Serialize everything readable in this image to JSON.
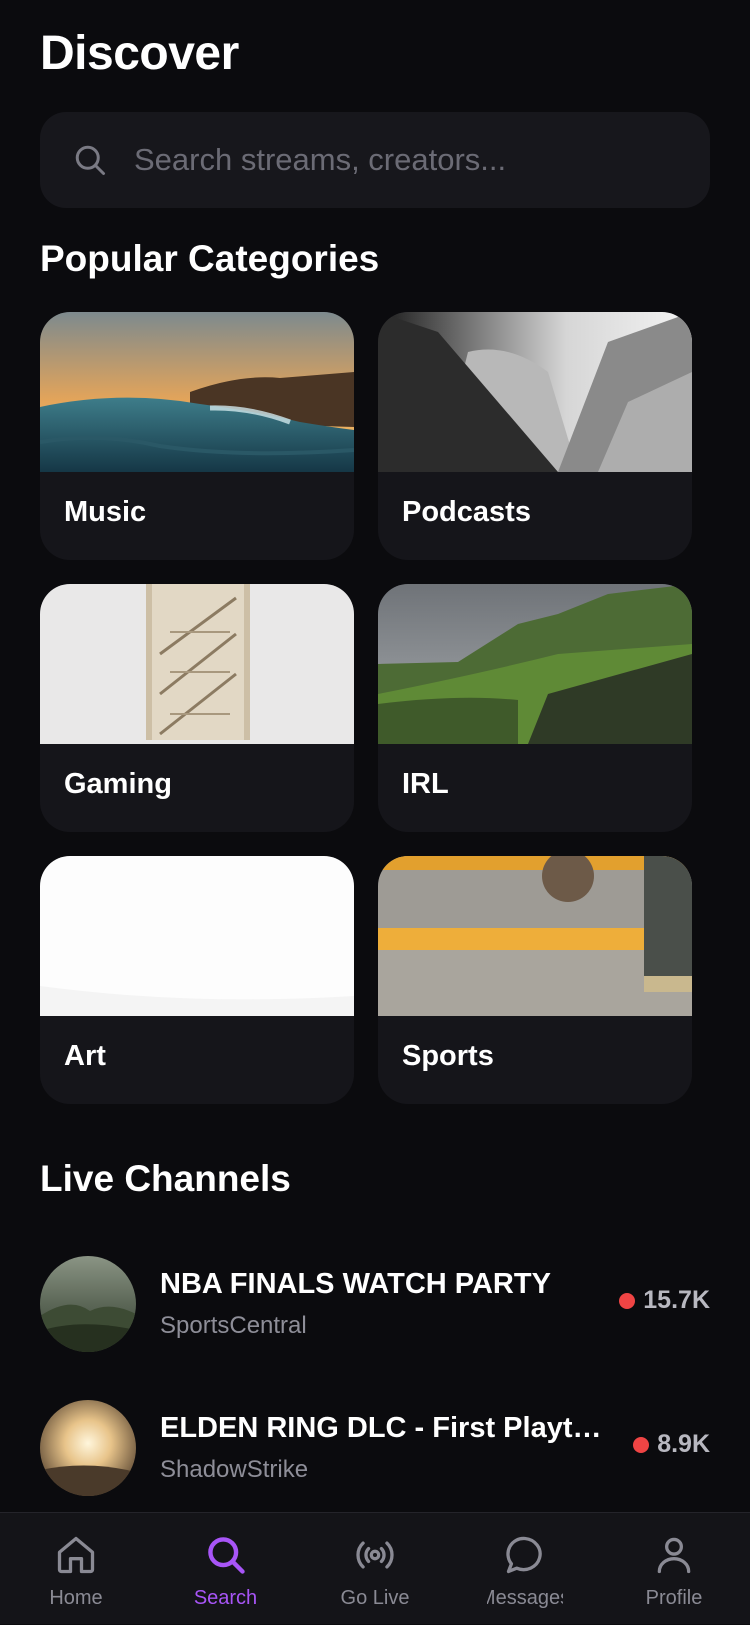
{
  "header": {
    "title": "Discover"
  },
  "search": {
    "placeholder": "Search streams, creators..."
  },
  "categories": {
    "title": "Popular Categories",
    "items": [
      {
        "label": "Music"
      },
      {
        "label": "Podcasts"
      },
      {
        "label": "Gaming"
      },
      {
        "label": "IRL"
      },
      {
        "label": "Art"
      },
      {
        "label": "Sports"
      }
    ]
  },
  "live": {
    "title": "Live Channels",
    "channels": [
      {
        "title": "NBA FINALS WATCH PARTY",
        "creator": "SportsCentral",
        "viewers": "15.7K"
      },
      {
        "title": "ELDEN RING DLC - First Playthr...",
        "creator": "ShadowStrike",
        "viewers": "8.9K"
      }
    ]
  },
  "tabs": [
    {
      "label": "Home",
      "icon": "home-icon"
    },
    {
      "label": "Search",
      "icon": "search-icon",
      "active": true
    },
    {
      "label": "Go Live",
      "icon": "broadcast-icon"
    },
    {
      "label": "Messages",
      "icon": "chat-icon"
    },
    {
      "label": "Profile",
      "icon": "user-icon"
    }
  ],
  "colors": {
    "accent": "#a855f7",
    "live": "#ef4444",
    "background": "#0b0b0e",
    "card": "#15151a"
  }
}
